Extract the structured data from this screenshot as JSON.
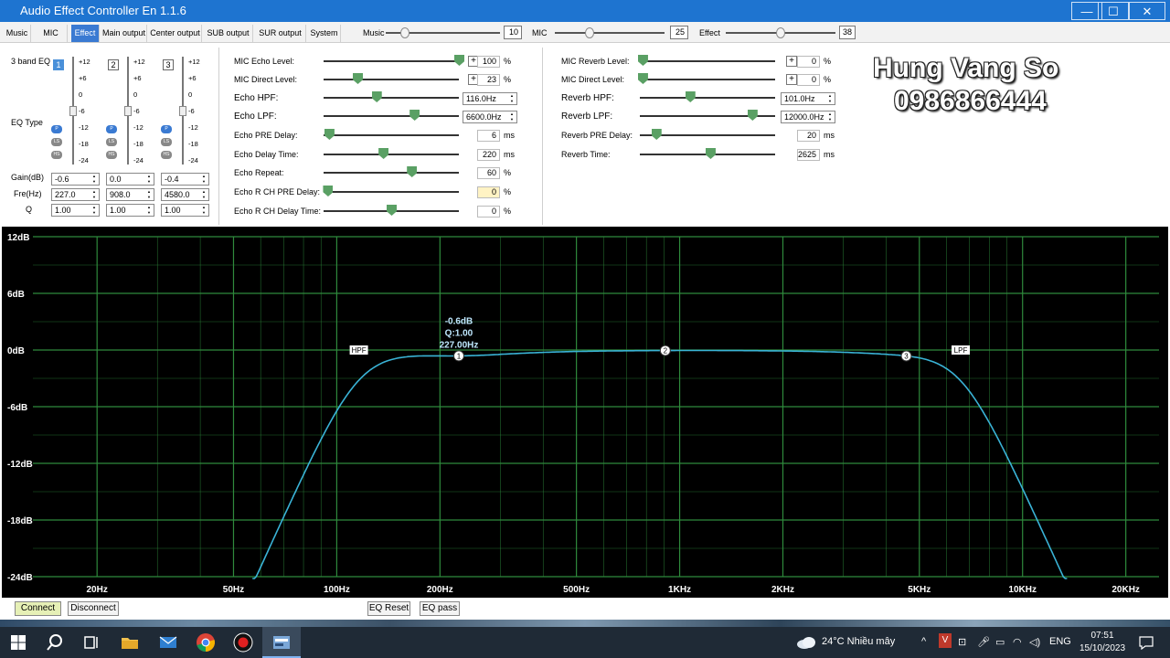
{
  "window": {
    "title": "Audio Effect Controller En 1.1.6",
    "min": "—",
    "max": "☐",
    "close": "✕"
  },
  "tabs": [
    {
      "label": "Music"
    },
    {
      "label": "MIC"
    },
    {
      "label": "Effect",
      "active": true
    },
    {
      "label": "Main output"
    },
    {
      "label": "Center output"
    },
    {
      "label": "SUB output"
    },
    {
      "label": "SUR  output"
    },
    {
      "label": "System"
    }
  ],
  "top_sliders": [
    {
      "label": "Music",
      "value": "10",
      "level": 0.17
    },
    {
      "label": "MIC",
      "value": "25",
      "level": 0.32
    },
    {
      "label": "Effect",
      "value": "38",
      "level": 0.5
    }
  ],
  "eq": {
    "title": "3 band EQ",
    "type_label": "EQ Type",
    "scale": [
      "+12",
      "+6",
      "0",
      "-6",
      "-12",
      "-18",
      "-24"
    ],
    "type_buttons": [
      "P",
      "LS",
      "HS"
    ],
    "gain_label": "Gain(dB)",
    "freq_label": "Fre(Hz)",
    "q_label": "Q",
    "bands": [
      {
        "num": "1",
        "gain": "-0.6",
        "freq": "227.0",
        "q": "1.00",
        "level": 0.5
      },
      {
        "num": "2",
        "gain": "0.0",
        "freq": "908.0",
        "q": "1.00",
        "level": 0.5
      },
      {
        "num": "3",
        "gain": "-0.4",
        "freq": "4580.0",
        "q": "1.00",
        "level": 0.5
      }
    ]
  },
  "echo_params": [
    {
      "label": "MIC Echo Level:",
      "value": "100",
      "unit": "%",
      "level": 1.0,
      "plus": true
    },
    {
      "label": "MIC Direct Level:",
      "value": "23",
      "unit": "%",
      "level": 0.25,
      "plus": true
    },
    {
      "label": "Echo HPF:",
      "value": "116.0Hz",
      "unit": "",
      "level": 0.39,
      "spin": true
    },
    {
      "label": "Echo LPF:",
      "value": "6600.0Hz",
      "unit": "",
      "level": 0.67,
      "spin": true
    },
    {
      "label": "Echo PRE Delay:",
      "value": "6",
      "unit": "ms",
      "level": 0.04
    },
    {
      "label": "Echo Delay Time:",
      "value": "220",
      "unit": "ms",
      "level": 0.44
    },
    {
      "label": "Echo Repeat:",
      "value": "60",
      "unit": "%",
      "level": 0.65
    },
    {
      "label": "Echo R CH PRE Delay:",
      "value": "0",
      "unit": "%",
      "level": 0.03,
      "highlight": true
    },
    {
      "label": "Echo R CH Delay Time:",
      "value": "0",
      "unit": "%",
      "level": 0.5
    }
  ],
  "reverb_params": [
    {
      "label": "MIC Reverb Level:",
      "value": "0",
      "unit": "%",
      "level": 0.02,
      "plus": true
    },
    {
      "label": "MIC Direct Level:",
      "value": "0",
      "unit": "%",
      "level": 0.02,
      "plus": true
    },
    {
      "label": "Reverb HPF:",
      "value": "101.0Hz",
      "unit": "",
      "level": 0.37,
      "spin": true
    },
    {
      "label": "Reverb LPF:",
      "value": "12000.0Hz",
      "unit": "",
      "level": 0.83,
      "spin": true
    },
    {
      "label": "Reverb PRE Delay:",
      "value": "20",
      "unit": "ms",
      "level": 0.12
    },
    {
      "label": "Reverb Time:",
      "value": "2625",
      "unit": "ms",
      "level": 0.52
    }
  ],
  "watermark": {
    "line1": "Hung Vang So",
    "line2": "0986866444"
  },
  "graph": {
    "y_labels": [
      "12dB",
      "6dB",
      "0dB",
      "-6dB",
      "-12dB",
      "-18dB",
      "-24dB"
    ],
    "x_labels": [
      "20Hz",
      "50Hz",
      "100Hz",
      "200Hz",
      "500Hz",
      "1KHz",
      "2KHz",
      "5KHz",
      "10KHz",
      "20KHz"
    ],
    "y_range": [
      -24,
      12
    ],
    "x_range_hz": [
      13,
      25000
    ],
    "hpf_label": "HPF",
    "lpf_label": "LPF",
    "hpf_hz": 116,
    "lpf_hz": 6600,
    "tooltip": [
      "-0.6dB",
      "Q:1.00",
      "227.00Hz"
    ],
    "points": [
      {
        "label": "1",
        "hz": 227,
        "db": -0.6
      },
      {
        "label": "2",
        "hz": 908,
        "db": 0.0
      },
      {
        "label": "3",
        "hz": 4580,
        "db": -0.4
      }
    ],
    "colors": {
      "curve": "#3ab3d6",
      "grid": "#2f8a3c",
      "bg": "#000000"
    }
  },
  "buttons": {
    "connect": "Connect",
    "disconnect": "Disconnect",
    "eq_reset": "EQ Reset",
    "eq_pass": "EQ pass"
  },
  "taskbar": {
    "weather": "24°C  Nhiều mây",
    "lang": "ENG",
    "time": "07:51",
    "date": "15/10/2023"
  }
}
